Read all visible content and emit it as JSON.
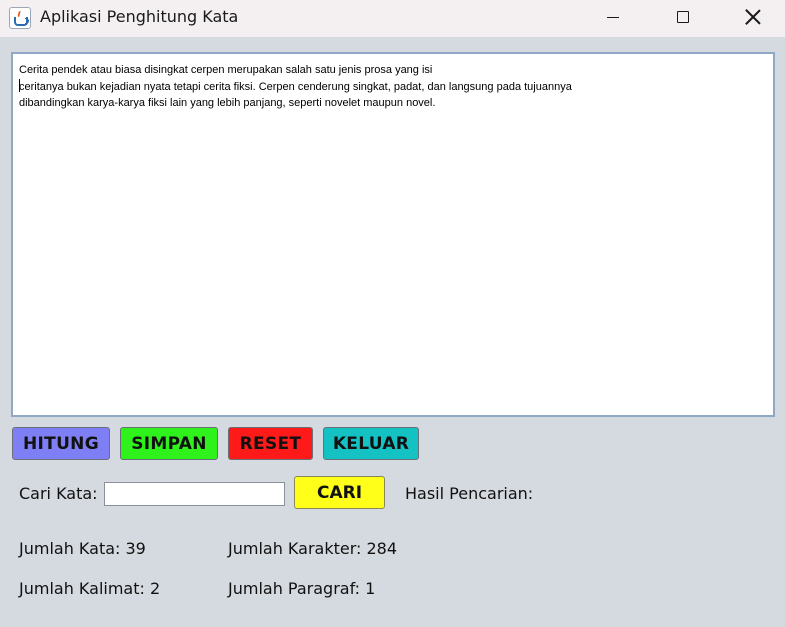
{
  "window": {
    "title": "Aplikasi Penghitung Kata",
    "icon": "java-cup-icon"
  },
  "editor": {
    "lines": [
      "Cerita pendek atau biasa disingkat cerpen merupakan salah satu jenis prosa yang isi",
      "ceritanya bukan kejadian nyata tetapi cerita fiksi. Cerpen cenderung singkat, padat, dan langsung pada tujuannya",
      "dibandingkan karya-karya fiksi lain yang lebih panjang, seperti novelet maupun novel."
    ]
  },
  "buttons": {
    "hitung": "HITUNG",
    "simpan": "SIMPAN",
    "reset": "RESET",
    "keluar": "KELUAR",
    "cari": "CARI"
  },
  "button_colors": {
    "hitung": "#7f7ff5",
    "simpan": "#2ff21c",
    "reset": "#ff1a1a",
    "keluar": "#14c2c4",
    "cari": "#ffff1a"
  },
  "search": {
    "label": "Cari Kata:",
    "value": "",
    "result_label": "Hasil Pencarian:"
  },
  "stats": {
    "jumlah_kata": "Jumlah Kata: 39",
    "jumlah_karakter": "Jumlah Karakter: 284",
    "jumlah_kalimat": "Jumlah Kalimat: 2",
    "jumlah_paragraf": "Jumlah Paragraf: 1"
  }
}
